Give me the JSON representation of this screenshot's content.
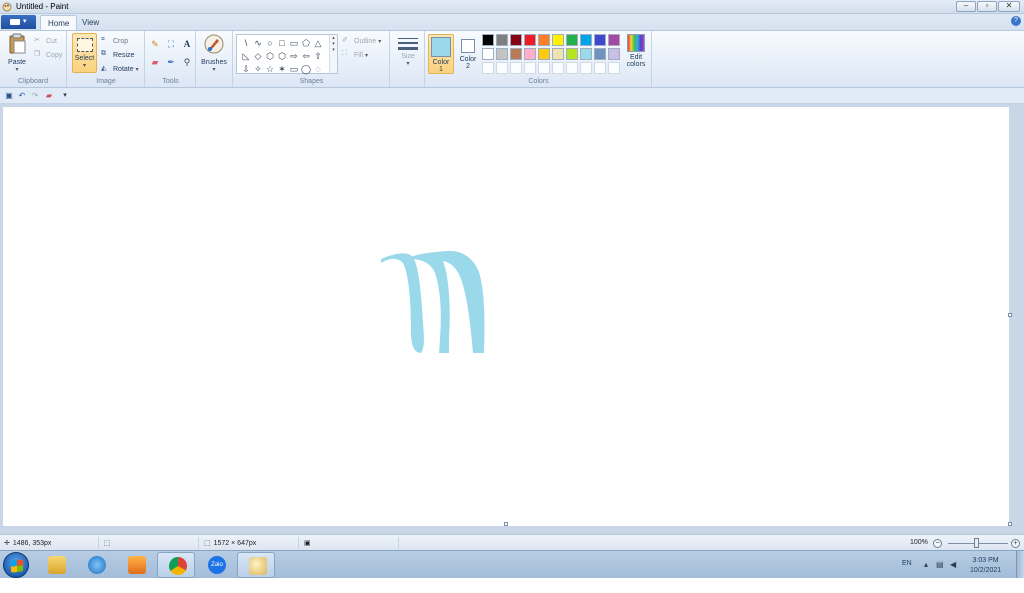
{
  "window": {
    "title": "Untitled - Paint",
    "controls": {
      "minimize": "–",
      "maximize": "▫",
      "close": "✕"
    }
  },
  "ribbon_tabs": {
    "items": [
      {
        "label": "Home",
        "active": true
      },
      {
        "label": "View",
        "active": false
      }
    ],
    "help": "?"
  },
  "clipboard": {
    "paste": "Paste",
    "cut": "Cut",
    "copy": "Copy",
    "group": "Clipboard"
  },
  "image": {
    "select": "Select",
    "crop": "Crop",
    "resize": "Resize",
    "rotate": "Rotate",
    "group": "Image"
  },
  "tools": {
    "group": "Tools",
    "text_tool": "A"
  },
  "brushes": {
    "label": "Brushes"
  },
  "shapes": {
    "group": "Shapes",
    "outline": "Outline",
    "fill": "Fill",
    "glyphs": [
      "\\",
      "∿",
      "○",
      "□",
      "▭",
      "⬠",
      "△",
      "",
      "◺",
      "◇",
      "⬡",
      "⬡",
      "⇨",
      "⇦",
      "⇧",
      "",
      "⇩",
      "✧",
      "☆",
      "✶",
      "▭",
      "◯",
      "◌",
      ""
    ]
  },
  "size": {
    "label": "Size"
  },
  "colors": {
    "group": "Colors",
    "color1_label": "Color",
    "color1_num": "1",
    "color2_label": "Color",
    "color2_num": "2",
    "color1_value": "#99d9ea",
    "color2_value": "#ffffff",
    "edit_label": "Edit",
    "edit_label2": "colors",
    "palette_row1": [
      "#000000",
      "#7f7f7f",
      "#880015",
      "#ed1c24",
      "#ff7f27",
      "#fff200",
      "#22b14c",
      "#00a2e8",
      "#3f48cc",
      "#a349a4"
    ],
    "palette_row2": [
      "#ffffff",
      "#c3c3c3",
      "#b97a57",
      "#ffaec9",
      "#ffc90e",
      "#efe4b0",
      "#b5e61d",
      "#99d9ea",
      "#7092be",
      "#c8bfe7"
    ]
  },
  "canvas": {
    "stroke_color": "#99d9ea"
  },
  "statusbar": {
    "cursor_pos": "1486, 353px",
    "image_size": "1572 × 647px",
    "zoom": "100%"
  },
  "taskbar": {
    "apps": [
      "Windows Explorer",
      "Internet Explorer",
      "Media Player",
      "Chrome",
      "Zalo",
      "Paint"
    ],
    "zalo_label": "Zalo",
    "lang": "EN",
    "time": "3:03 PM",
    "date": "10/2/2021"
  }
}
